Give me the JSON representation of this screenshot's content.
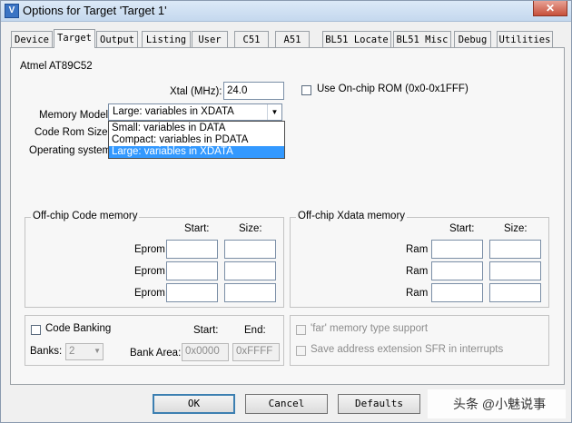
{
  "window": {
    "title": "Options for Target 'Target 1'",
    "icon_glyph": "V",
    "close_glyph": "✕"
  },
  "tabs": [
    {
      "label": "Device"
    },
    {
      "label": "Target"
    },
    {
      "label": "Output"
    },
    {
      "label": "Listing"
    },
    {
      "label": "User"
    },
    {
      "label": "C51"
    },
    {
      "label": "A51"
    },
    {
      "label": "BL51 Locate"
    },
    {
      "label": "BL51 Misc"
    },
    {
      "label": "Debug"
    },
    {
      "label": "Utilities"
    }
  ],
  "active_tab": "Target",
  "device": "Atmel AT89C52",
  "xtal": {
    "label": "Xtal (MHz):",
    "value": "24.0"
  },
  "onchip_rom": {
    "label": "Use On-chip ROM (0x0-0x1FFF)",
    "checked": false
  },
  "memory_model": {
    "label": "Memory Model:",
    "selected": "Large: variables in XDATA",
    "options": [
      "Small: variables in DATA",
      "Compact: variables in PDATA",
      "Large: variables in XDATA"
    ],
    "highlighted_index": 2
  },
  "code_rom_size": {
    "label": "Code Rom Size:"
  },
  "operating_system": {
    "label": "Operating system:"
  },
  "offchip_code": {
    "title": "Off-chip Code memory",
    "start_header": "Start:",
    "size_header": "Size:",
    "rows": [
      {
        "label": "Eprom"
      },
      {
        "label": "Eprom"
      },
      {
        "label": "Eprom"
      }
    ]
  },
  "offchip_xdata": {
    "title": "Off-chip Xdata memory",
    "start_header": "Start:",
    "size_header": "Size:",
    "rows": [
      {
        "label": "Ram"
      },
      {
        "label": "Ram"
      },
      {
        "label": "Ram"
      }
    ]
  },
  "code_banking": {
    "label": "Code Banking",
    "checked": false,
    "start_header": "Start:",
    "end_header": "End:",
    "banks_label": "Banks:",
    "banks_value": "2",
    "bank_area_label": "Bank Area:",
    "start_value": "0x0000",
    "end_value": "0xFFFF"
  },
  "far_memory": {
    "label": "'far' memory type support",
    "checked": false,
    "enabled": false
  },
  "save_sfr": {
    "label": "Save address extension SFR in interrupts",
    "checked": false,
    "enabled": false
  },
  "buttons": {
    "ok": "OK",
    "cancel": "Cancel",
    "defaults": "Defaults"
  },
  "watermark": {
    "text": "头条 @小魅说事"
  },
  "colors": {
    "selection": "#3399ff",
    "titlebar": "#c4d8ee",
    "close": "#c7503b"
  }
}
